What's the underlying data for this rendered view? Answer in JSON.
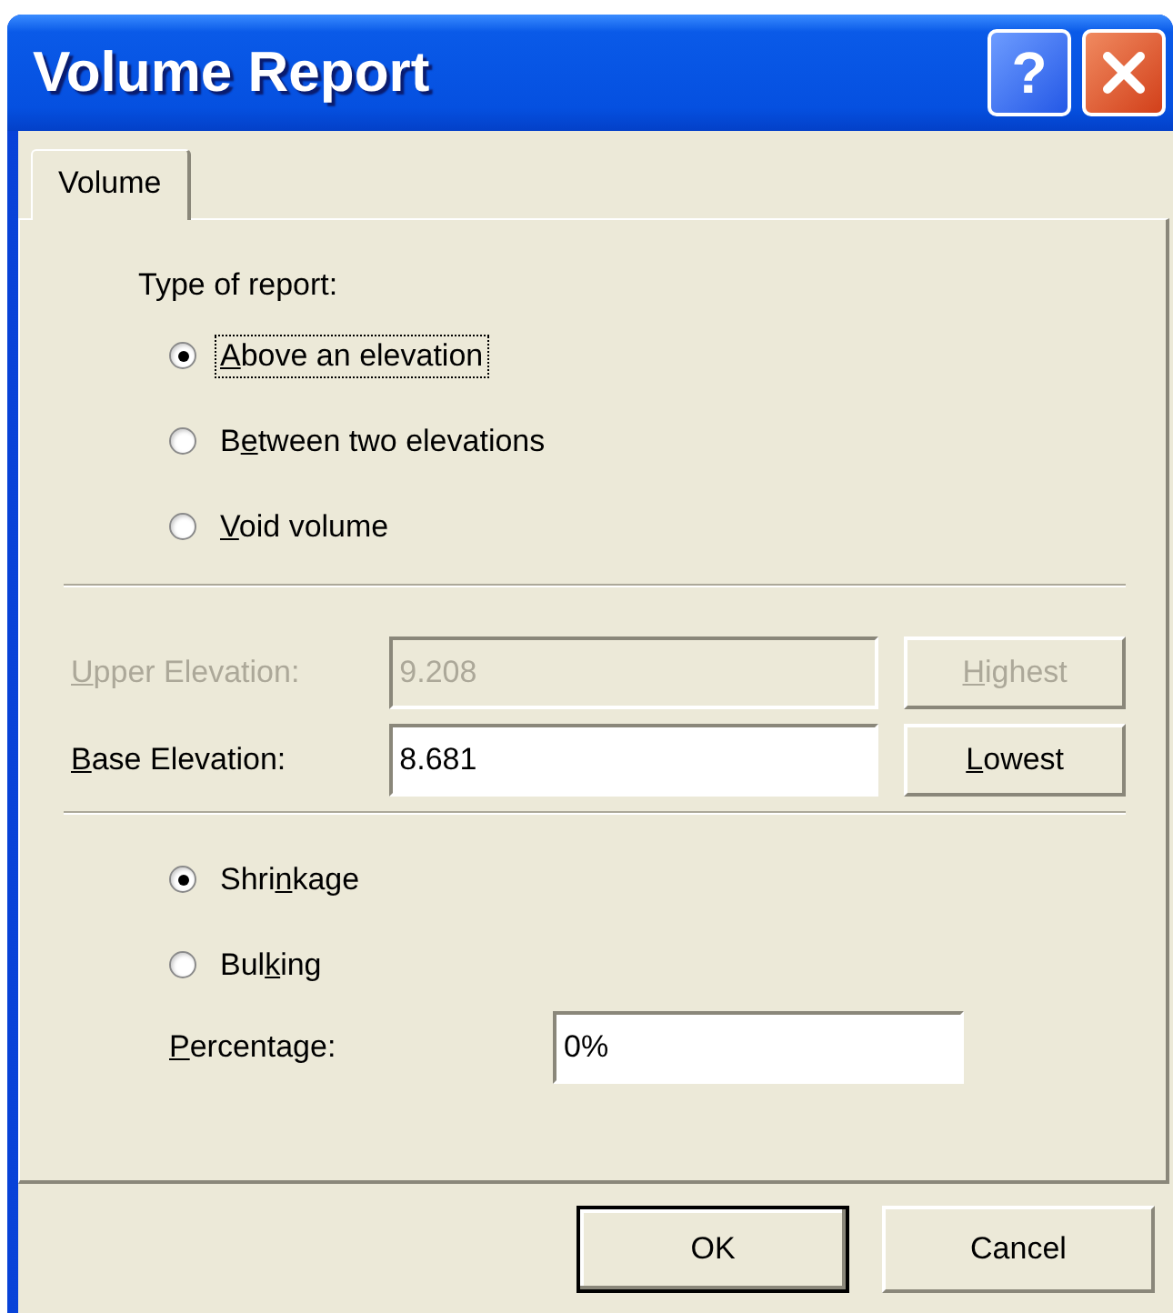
{
  "window": {
    "title": "Volume Report",
    "title_buttons": [
      {
        "kind": "help",
        "label": "?"
      },
      {
        "kind": "close"
      }
    ]
  },
  "tabs": [
    {
      "label": "Volume",
      "selected": true
    }
  ],
  "report_type": {
    "label": "Type of report:",
    "options": [
      {
        "label": {
          "access_key": "A",
          "post": "bove an elevation"
        },
        "selected": true,
        "focused": true
      },
      {
        "label": {
          "pre": "B",
          "access_key": "e",
          "post": "tween two elevations"
        },
        "selected": false,
        "focused": false
      },
      {
        "label": {
          "access_key": "V",
          "post": "oid volume"
        },
        "selected": false,
        "focused": false
      }
    ]
  },
  "elevations": [
    {
      "label": {
        "access_key": "U",
        "post": "pper Elevation:"
      },
      "value": "9.208",
      "button": {
        "access_key": "H",
        "post": "ighest"
      },
      "disabled": true
    },
    {
      "label": {
        "access_key": "B",
        "post": "ase Elevation:"
      },
      "value": "8.681",
      "button": {
        "access_key": "L",
        "post": "owest"
      },
      "disabled": false
    }
  ],
  "adjustment": {
    "options": [
      {
        "label": {
          "pre": "Shri",
          "access_key": "n",
          "post": "kage"
        },
        "selected": true
      },
      {
        "label": {
          "pre": "Bul",
          "access_key": "k",
          "post": "ing"
        },
        "selected": false
      }
    ],
    "percentage": {
      "label": {
        "access_key": "P",
        "post": "ercentage:"
      },
      "value": "0%"
    }
  },
  "buttons": [
    {
      "label": "OK",
      "default": true
    },
    {
      "label": "Cancel",
      "default": false
    }
  ]
}
